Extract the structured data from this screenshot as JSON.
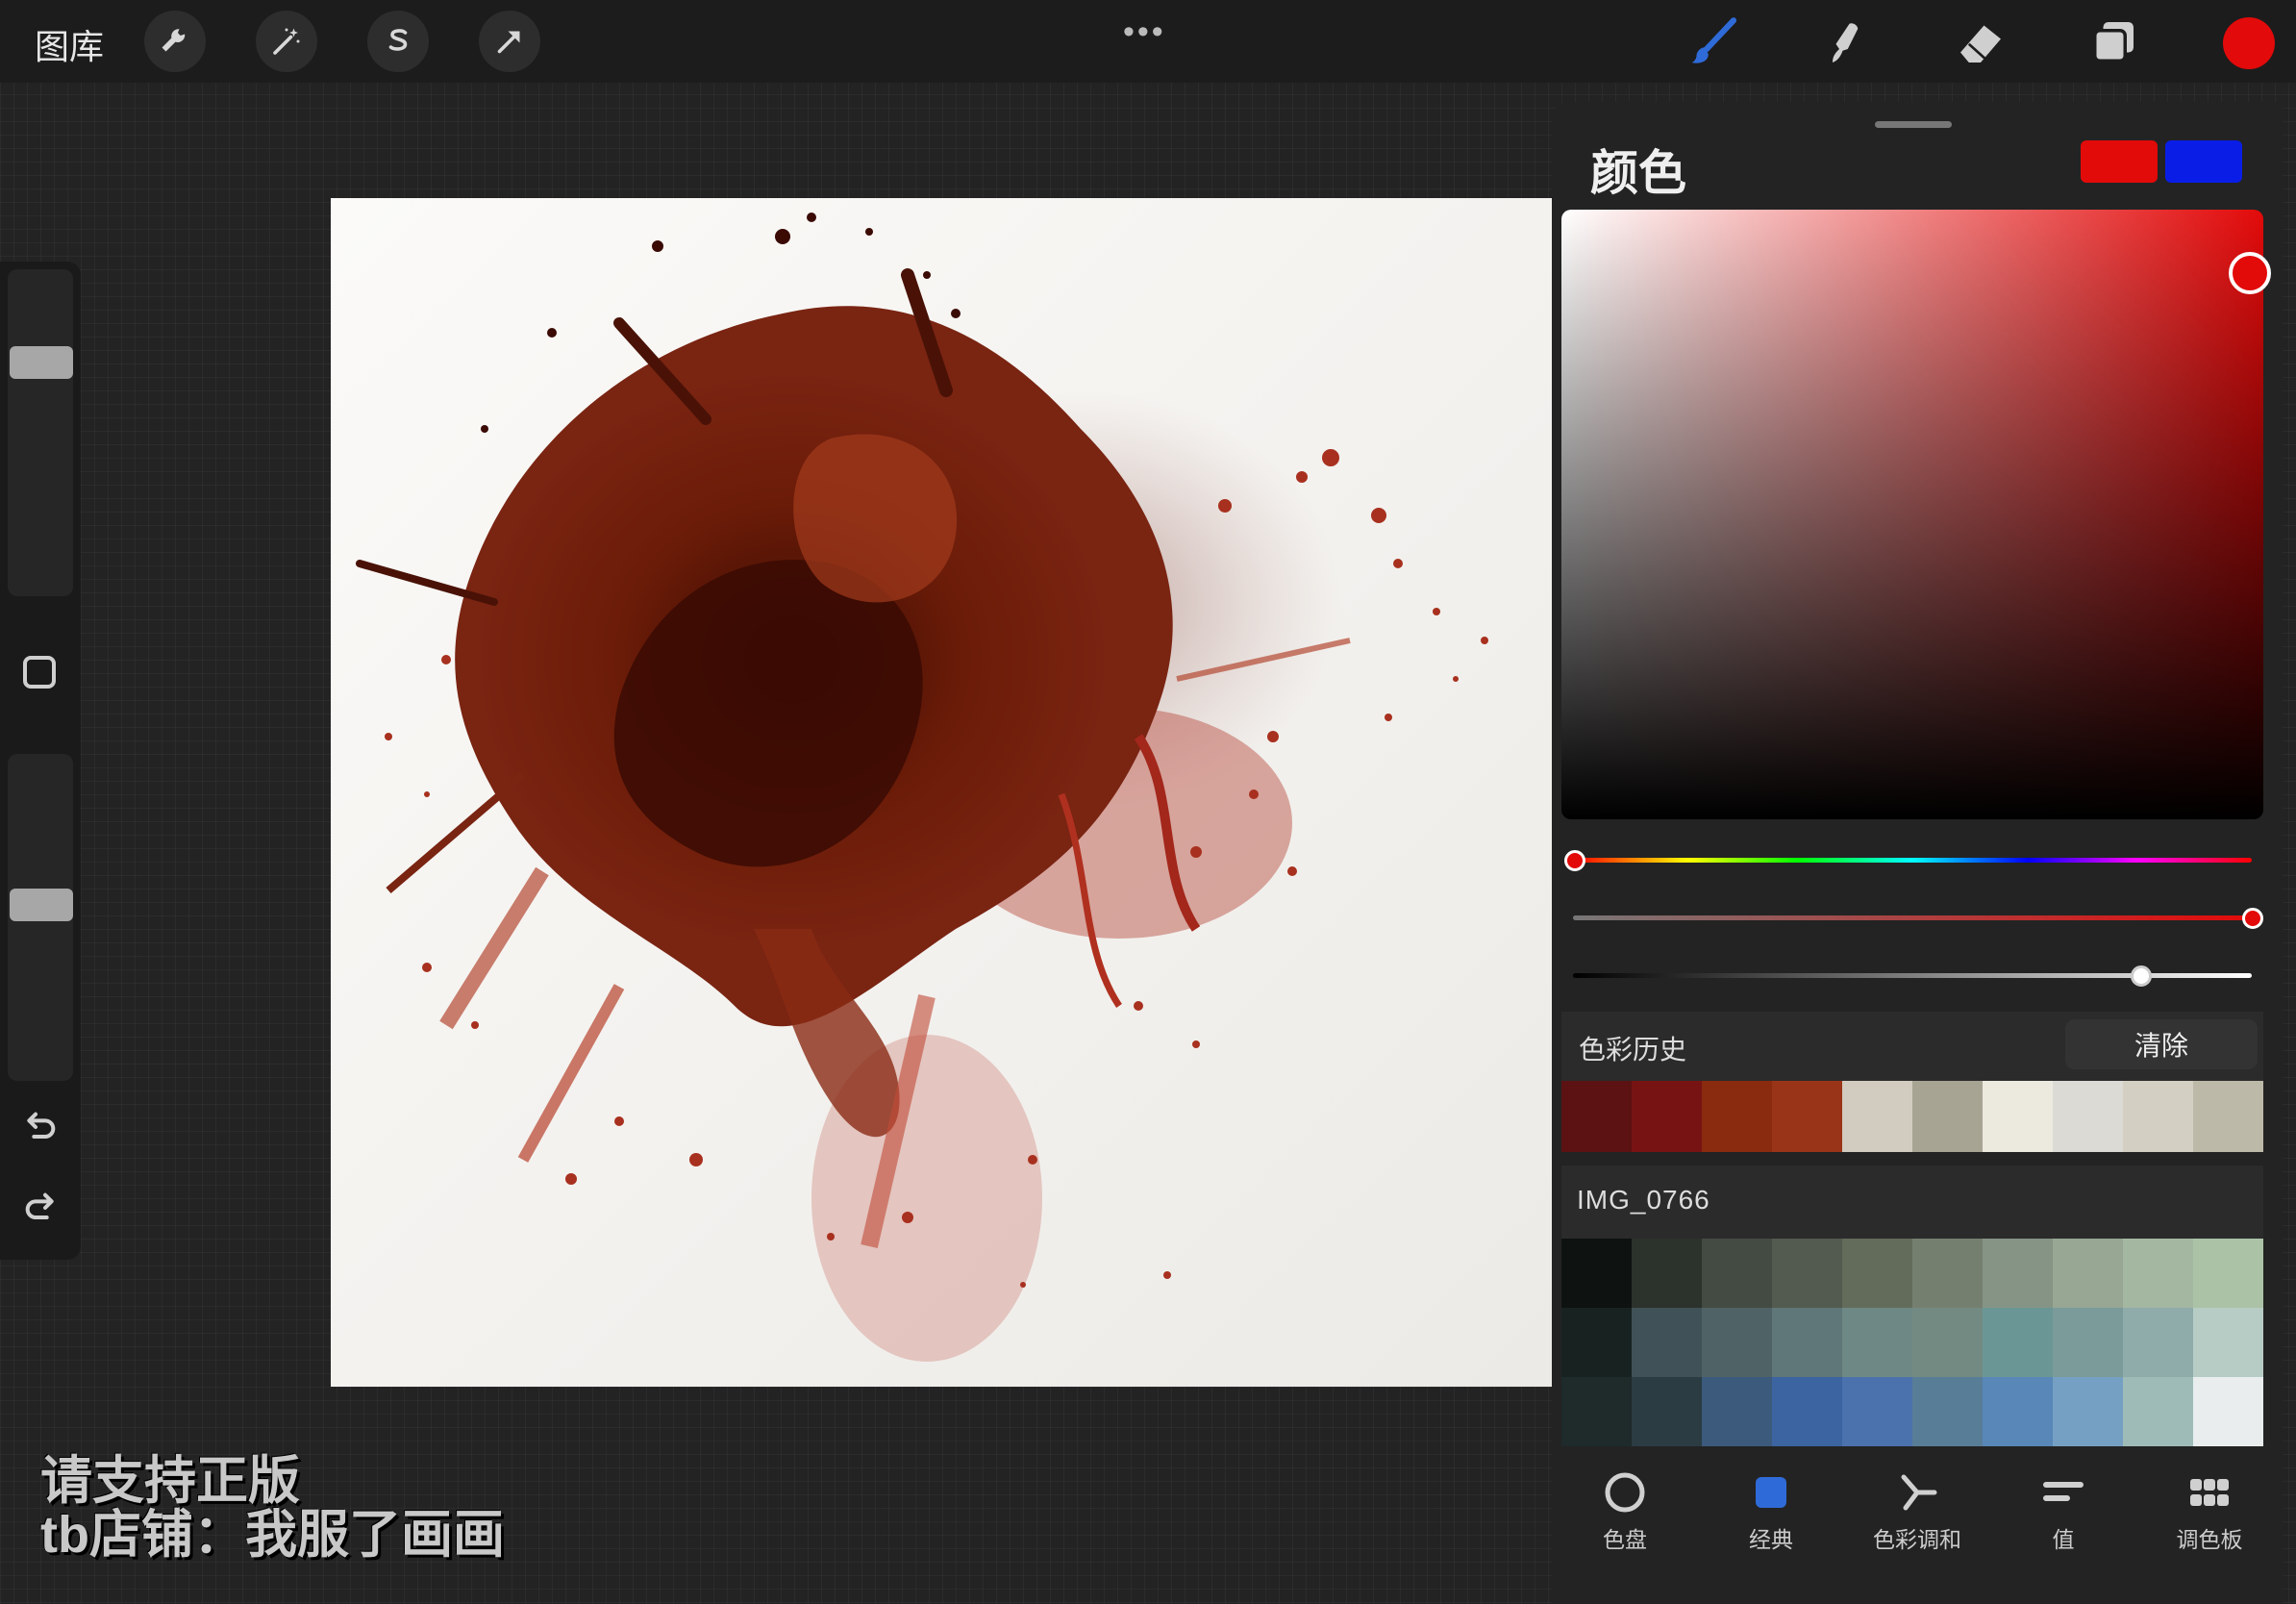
{
  "topbar": {
    "gallery_label": "图库",
    "more_label": "•••",
    "left_tools": [
      "wrench-icon",
      "magic-wand-icon",
      "selection-s-icon",
      "transform-arrow-icon"
    ],
    "right_tools": [
      "brush-icon",
      "smudge-icon",
      "eraser-icon",
      "layers-icon"
    ],
    "active_color": "#e20a0a"
  },
  "sidebar": {
    "size_slider_level": 0.3,
    "opacity_slider_level": 0.45
  },
  "watermark": {
    "line1": "请支持正版",
    "line2": "tb店铺：我服了画画"
  },
  "color_panel": {
    "title": "颜色",
    "primary_color": "#e30a0a",
    "secondary_color": "#0a1de6",
    "hue_level": 0.0,
    "saturation_level": 1.0,
    "brightness_level": 0.83,
    "history_label": "色彩历史",
    "clear_label": "清除",
    "history": [
      "#5c1212",
      "#781313",
      "#8a2a0e",
      "#9a3418",
      "#d2cbbf",
      "#a7a494",
      "#ece9df",
      "#dcdad4",
      "#d3cfc2",
      "#bdb9a8"
    ],
    "palette_name": "IMG_0766",
    "palette": [
      "#0e1311",
      "#2c322c",
      "#444b43",
      "#535a4f",
      "#636b5b",
      "#757f70",
      "#869486",
      "#97a794",
      "#a4b8a1",
      "#abc2a6",
      "#182221",
      "#405257",
      "#4f6366",
      "#5f7779",
      "#6e8985",
      "#738a83",
      "#6a9795",
      "#7b9b9a",
      "#8fabaa",
      "#b7ccc5",
      "#1f2a2b",
      "#2b3c43",
      "#3b5a7c",
      "#3b64a1",
      "#4c72ad",
      "#587d97",
      "#5887b8",
      "#75a0c3",
      "#9ebbb7",
      "#e9edee"
    ],
    "tabs": [
      {
        "label": "色盘",
        "icon": "disc-ring-icon"
      },
      {
        "label": "经典",
        "icon": "classic-square-icon"
      },
      {
        "label": "色彩调和",
        "icon": "harmony-icon"
      },
      {
        "label": "值",
        "icon": "value-bars-icon"
      },
      {
        "label": "调色板",
        "icon": "palette-grid-icon"
      }
    ]
  }
}
